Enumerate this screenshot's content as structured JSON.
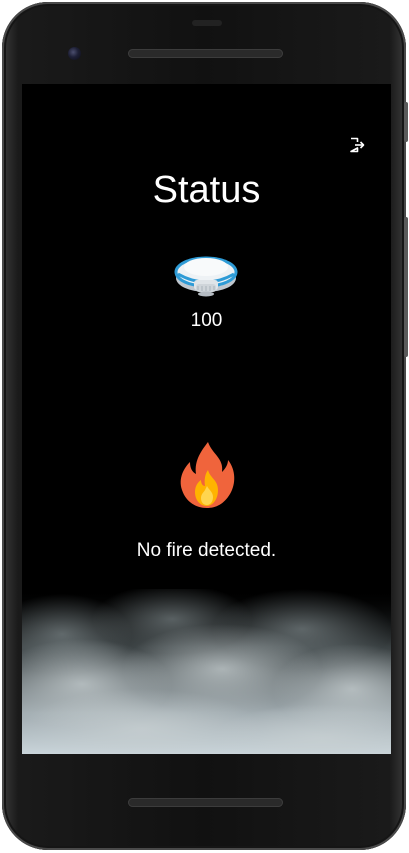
{
  "status_screen": {
    "title": "Status",
    "detector_value": "100",
    "fire_status_text": "No fire detected."
  },
  "icons": {
    "logout": "logout-icon",
    "detector": "smoke-detector-icon",
    "fire": "fire-icon"
  },
  "colors": {
    "background": "#000000",
    "text": "#ffffff",
    "detector_ring": "#2e9bd6",
    "fire_outer": "#f0643c",
    "fire_inner": "#ffb300"
  }
}
